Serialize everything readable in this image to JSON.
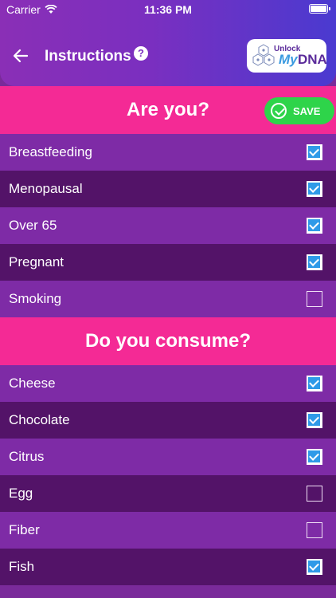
{
  "status_bar": {
    "carrier": "Carrier",
    "time": "11:36 PM"
  },
  "header": {
    "title": "Instructions",
    "help": "?"
  },
  "logo": {
    "line1": "Unlock",
    "line2": "My",
    "line3": "DNA"
  },
  "save_label": "SAVE",
  "sections": [
    {
      "title": "Are you?",
      "items": [
        {
          "label": "Breastfeeding",
          "checked": true
        },
        {
          "label": "Menopausal",
          "checked": true
        },
        {
          "label": "Over 65",
          "checked": true
        },
        {
          "label": "Pregnant",
          "checked": true
        },
        {
          "label": "Smoking",
          "checked": false
        }
      ]
    },
    {
      "title": "Do you consume?",
      "items": [
        {
          "label": "Cheese",
          "checked": true
        },
        {
          "label": "Chocolate",
          "checked": true
        },
        {
          "label": "Citrus",
          "checked": true
        },
        {
          "label": "Egg",
          "checked": false
        },
        {
          "label": "Fiber",
          "checked": false
        },
        {
          "label": "Fish",
          "checked": true
        }
      ]
    }
  ],
  "colors": {
    "pink": "#f42a95",
    "save_green": "#2ed44a",
    "row_light": "#7e2ba6",
    "row_dark": "#531368",
    "check_blue": "#2f9ae8"
  }
}
